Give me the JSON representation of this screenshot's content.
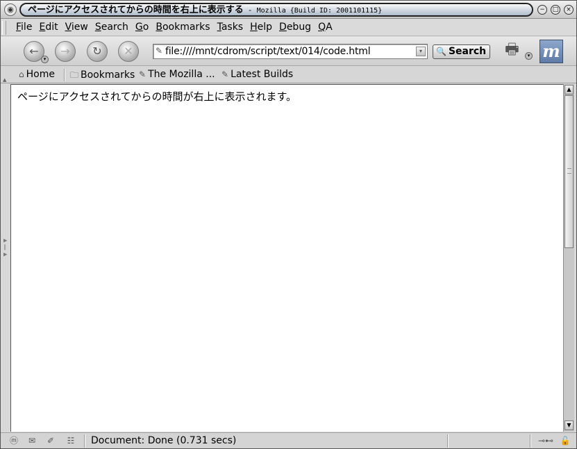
{
  "titlebar": {
    "title": "ページにアクセスされてからの時間を右上に表示する",
    "separator": "-",
    "app": "Mozilla {Build ID: 2001101115}"
  },
  "menubar": {
    "items": [
      {
        "first": "F",
        "rest": "ile"
      },
      {
        "first": "E",
        "rest": "dit"
      },
      {
        "first": "V",
        "rest": "iew"
      },
      {
        "first": "S",
        "rest": "earch"
      },
      {
        "first": "G",
        "rest": "o"
      },
      {
        "first": "B",
        "rest": "ookmarks"
      },
      {
        "first": "T",
        "rest": "asks"
      },
      {
        "first": "H",
        "rest": "elp"
      },
      {
        "first": "D",
        "rest": "ebug"
      },
      {
        "first": "Q",
        "rest": "A"
      }
    ]
  },
  "navbar": {
    "url": "file:////mnt/cdrom/script/text/014/code.html",
    "search_label": "Search"
  },
  "personalbar": {
    "home": "Home",
    "bookmarks": "Bookmarks",
    "mozilla": "The Mozilla ...",
    "latest": "Latest Builds"
  },
  "content": {
    "text": "ページにアクセスされてからの時間が右上に表示されます。"
  },
  "status": {
    "text": "Document: Done (0.731 secs)"
  },
  "icons": {
    "back": "back-arrow-icon",
    "forward": "forward-arrow-icon",
    "reload": "reload-icon",
    "stop": "stop-icon",
    "print": "print-icon",
    "logo": "mozilla-logo-icon"
  }
}
